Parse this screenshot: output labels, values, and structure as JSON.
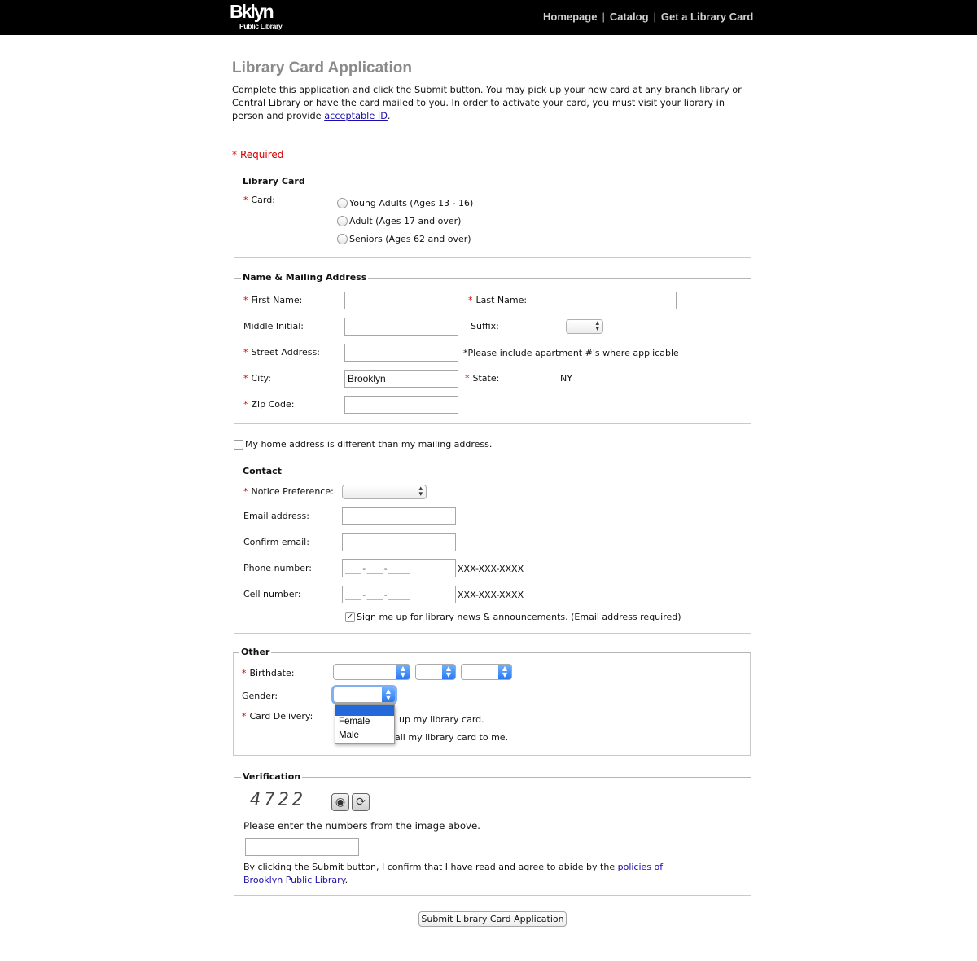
{
  "header": {
    "logo_line1": "Bklyn",
    "logo_line2": "Public Library",
    "nav": [
      "Homepage",
      "Catalog",
      "Get a Library Card"
    ],
    "separator": "|"
  },
  "page": {
    "title": "Library Card Application",
    "intro_text": "Complete this application and click the Submit button. You may pick up your new card at any branch library or Central Library or have the card mailed to you. In order to activate your card, you must visit your library in person and provide ",
    "intro_link": "acceptable ID",
    "intro_end": ".",
    "required_marker": "*",
    "required_label": "Required"
  },
  "library_card": {
    "legend": "Library Card",
    "card_label": "Card:",
    "options": [
      "Young Adults (Ages 13 - 16)",
      "Adult (Ages 17 and over)",
      "Seniors (Ages 62 and over)"
    ]
  },
  "address": {
    "legend": "Name & Mailing Address",
    "first_name_label": "First Name:",
    "last_name_label": "Last Name:",
    "middle_initial_label": "Middle Initial:",
    "suffix_label": "Suffix:",
    "street_label": "Street Address:",
    "street_hint": "*Please include apartment #'s where applicable",
    "city_label": "City:",
    "city_value": "Brooklyn",
    "state_label": "State:",
    "state_value": "NY",
    "zip_label": "Zip Code:"
  },
  "home_address_label": "My home address is different than my mailing address.",
  "contact": {
    "legend": "Contact",
    "notice_label": "Notice Preference:",
    "email_label": "Email address:",
    "confirm_email_label": "Confirm email:",
    "phone_label": "Phone number:",
    "phone_mask": "___-___-____",
    "phone_format": "XXX-XXX-XXXX",
    "cell_label": "Cell number:",
    "cell_mask": "___-___-____",
    "cell_format": "XXX-XXX-XXXX",
    "signup_label": "Sign me up for library news & announcements. (Email address required)",
    "signup_checked": true
  },
  "other": {
    "legend": "Other",
    "birthdate_label": "Birthdate:",
    "gender_label": "Gender:",
    "gender_options": [
      "",
      "Female",
      "Male"
    ],
    "delivery_label": "Card Delivery:",
    "delivery_option1_visible": "up my library card.",
    "delivery_option2_visible": "ail my library card to me."
  },
  "verification": {
    "legend": "Verification",
    "captcha_digits": "4722",
    "instruction": "Please enter the numbers from the image above.",
    "agree_text": "By clicking the Submit button, I confirm that I have read and agree to abide by the ",
    "agree_link_line1": "policies of",
    "agree_link_line2": "Brooklyn Public Library",
    "agree_end": "."
  },
  "submit_label": "Submit Library Card Application",
  "colors": {
    "header_bg": "#000000",
    "title_gray": "#8a8a8a",
    "required_red": "#d40000",
    "link_blue": "#1a0dab",
    "select_blue": "#2a78f0"
  },
  "icons": {
    "audio": "speaker-icon",
    "refresh": "refresh-icon"
  }
}
